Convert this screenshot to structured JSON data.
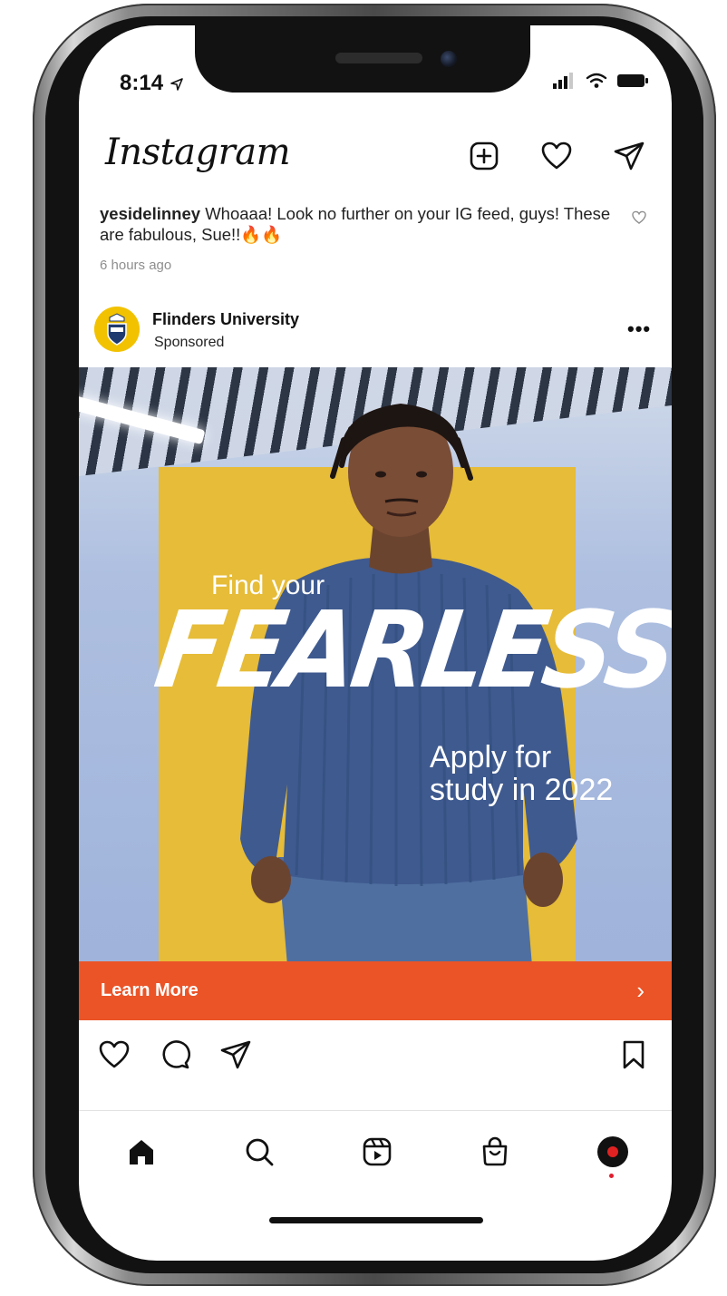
{
  "status_bar": {
    "time": "8:14"
  },
  "header": {
    "app_name": "Instagram"
  },
  "comment": {
    "username": "yesidelinney",
    "text": "Whoaaa! Look no further on your IG feed, guys! These are fabulous, Sue!!🔥🔥",
    "timestamp": "6 hours ago"
  },
  "post": {
    "username": "Flinders University",
    "label": "Sponsored",
    "more": "•••",
    "ad": {
      "line1": "Find your",
      "headline": "FEARLESS",
      "line2a": "Apply for",
      "line2b": "study in 2022"
    },
    "cta_label": "Learn More",
    "cta_chevron": "›"
  },
  "colors": {
    "cta": "#eb5427",
    "ad_yellow": "#e6bc38",
    "avatar_yellow": "#f2c200",
    "notification": "#e11d2e"
  },
  "icons": {
    "header": [
      "new-post-icon",
      "heart-icon",
      "direct-message-icon"
    ],
    "actions": [
      "like-icon",
      "comment-icon",
      "share-icon",
      "bookmark-icon"
    ],
    "nav": [
      "home-icon",
      "search-icon",
      "reels-icon",
      "shop-icon",
      "profile-avatar"
    ]
  }
}
